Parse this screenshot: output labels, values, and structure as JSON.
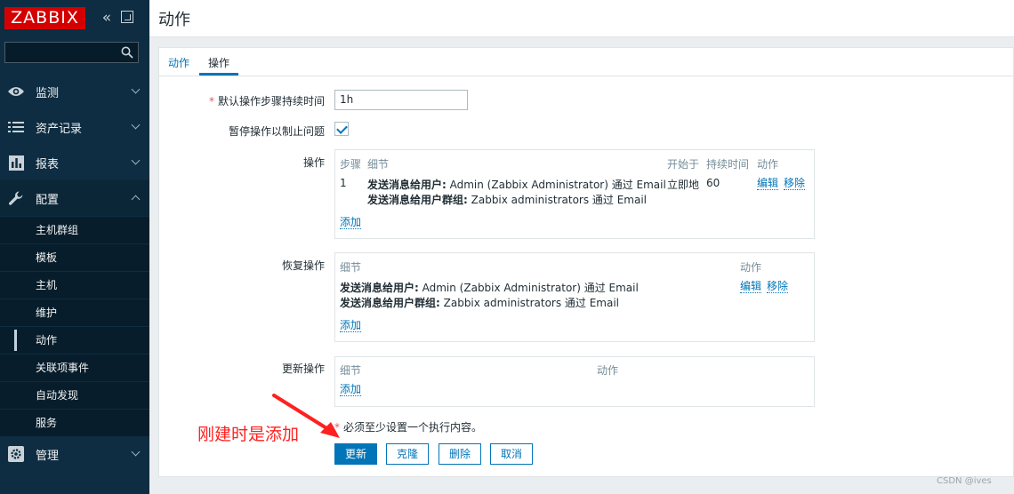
{
  "sidebar": {
    "logo": "ZABBIX",
    "search_placeholder": "",
    "menu": [
      {
        "label": "监测",
        "icon": "eye-icon"
      },
      {
        "label": "资产记录",
        "icon": "list-icon"
      },
      {
        "label": "报表",
        "icon": "bar-chart-icon"
      },
      {
        "label": "配置",
        "icon": "wrench-icon"
      },
      {
        "label": "管理",
        "icon": "gear-icon"
      }
    ],
    "config_submenu": [
      "主机群组",
      "模板",
      "主机",
      "维护",
      "动作",
      "关联项事件",
      "自动发现",
      "服务"
    ],
    "selected_submenu": "动作"
  },
  "header": {
    "title": "动作"
  },
  "tabs": [
    {
      "label": "动作"
    },
    {
      "label": "操作"
    }
  ],
  "form": {
    "duration_label": "默认操作步骤持续时间",
    "duration_value": "1h",
    "pause_label": "暂停操作以制止问题",
    "pause_checked": true,
    "operations_label": "操作",
    "operations": {
      "headers": {
        "step": "步骤",
        "details": "细节",
        "start": "开始于",
        "duration": "持续时间",
        "action": "动作"
      },
      "rows": [
        {
          "step": "1",
          "line1_bold": "发送消息给用户:",
          "line1_text": " Admin (Zabbix Administrator) 通过 Email",
          "line2_bold": "发送消息给用户群组:",
          "line2_text": " Zabbix administrators 通过 Email",
          "start": "立即地",
          "duration": "60",
          "edit": "编辑",
          "remove": "移除"
        }
      ],
      "add": "添加"
    },
    "recovery_label": "恢复操作",
    "recovery": {
      "headers": {
        "details": "细节",
        "action": "动作"
      },
      "line1_bold": "发送消息给用户:",
      "line1_text": " Admin (Zabbix Administrator) 通过 Email",
      "line2_bold": "发送消息给用户群组:",
      "line2_text": " Zabbix administrators 通过 Email",
      "edit": "编辑",
      "remove": "移除",
      "add": "添加"
    },
    "update_label": "更新操作",
    "update": {
      "headers": {
        "details": "细节",
        "action": "动作"
      },
      "add": "添加"
    },
    "required_note": "必须至少设置一个执行内容。",
    "buttons": {
      "update": "更新",
      "clone": "克隆",
      "delete": "删除",
      "cancel": "取消"
    }
  },
  "annotation": "刚建时是添加",
  "watermark": "CSDN @ives"
}
